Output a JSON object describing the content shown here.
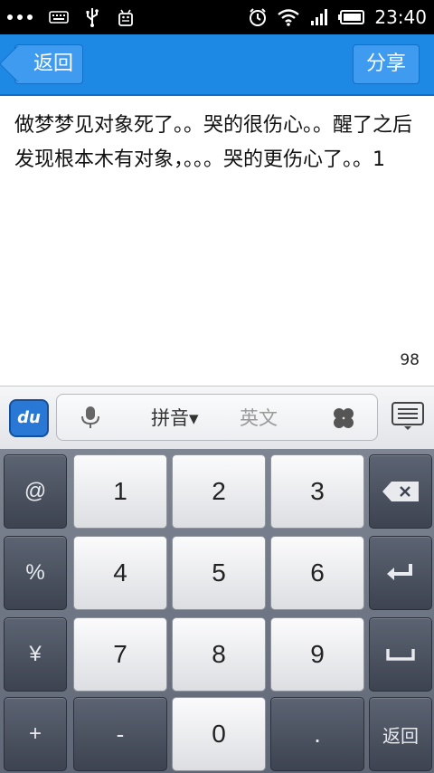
{
  "statusbar": {
    "time": "23:40"
  },
  "header": {
    "back_label": "返回",
    "share_label": "分享"
  },
  "content": {
    "text": "做梦梦见对象死了。。哭的很伤心。。醒了之后发现根本木有对象，。。。哭的更伤心了。。1",
    "remaining_count": "98"
  },
  "ime": {
    "logo": "du",
    "pinyin_label": "拼音▾",
    "english_label": "英文"
  },
  "keyboard": {
    "left_col": [
      "@",
      "%",
      "¥",
      "+"
    ],
    "digits_row1": [
      "1",
      "2",
      "3"
    ],
    "digits_row2": [
      "4",
      "5",
      "6"
    ],
    "digits_row3": [
      "7",
      "8",
      "9"
    ],
    "bottom_row": [
      "-",
      "0",
      "."
    ],
    "return_label": "返回"
  }
}
